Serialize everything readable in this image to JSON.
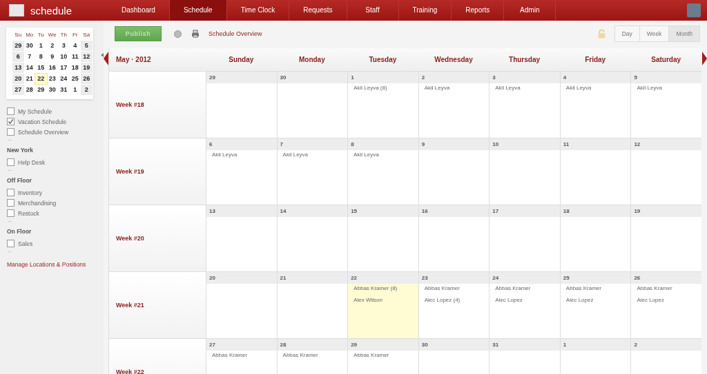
{
  "app": {
    "logo_text": "schedule"
  },
  "nav": [
    {
      "label": "Dashboard",
      "selected": false
    },
    {
      "label": "Schedule",
      "selected": true
    },
    {
      "label": "Time Clock",
      "selected": false
    },
    {
      "label": "Requests",
      "selected": false
    },
    {
      "label": "Staff",
      "selected": false
    },
    {
      "label": "Training",
      "selected": false
    },
    {
      "label": "Reports",
      "selected": false
    },
    {
      "label": "Admin",
      "selected": false
    }
  ],
  "sidebar": {
    "mini_calendar": {
      "weekdays": [
        "Su",
        "Mo",
        "Tu",
        "We",
        "Th",
        "Fr",
        "Sa"
      ],
      "weeks": [
        [
          {
            "day": "29",
            "today": false
          },
          {
            "day": "30",
            "today": false
          },
          {
            "day": "1",
            "today": false
          },
          {
            "day": "2",
            "today": false
          },
          {
            "day": "3",
            "today": false
          },
          {
            "day": "4",
            "today": false
          },
          {
            "day": "5",
            "today": false
          }
        ],
        [
          {
            "day": "6",
            "today": false
          },
          {
            "day": "7",
            "today": false
          },
          {
            "day": "8",
            "today": false
          },
          {
            "day": "9",
            "today": false
          },
          {
            "day": "10",
            "today": false
          },
          {
            "day": "11",
            "today": false
          },
          {
            "day": "12",
            "today": false
          }
        ],
        [
          {
            "day": "13",
            "today": false
          },
          {
            "day": "14",
            "today": false
          },
          {
            "day": "15",
            "today": false
          },
          {
            "day": "16",
            "today": false
          },
          {
            "day": "17",
            "today": false
          },
          {
            "day": "18",
            "today": false
          },
          {
            "day": "19",
            "today": false
          }
        ],
        [
          {
            "day": "20",
            "today": false
          },
          {
            "day": "21",
            "today": false
          },
          {
            "day": "22",
            "today": true
          },
          {
            "day": "23",
            "today": false
          },
          {
            "day": "24",
            "today": false
          },
          {
            "day": "25",
            "today": false
          },
          {
            "day": "26",
            "today": false
          }
        ],
        [
          {
            "day": "27",
            "today": false
          },
          {
            "day": "28",
            "today": false
          },
          {
            "day": "29",
            "today": false
          },
          {
            "day": "30",
            "today": false
          },
          {
            "day": "31",
            "today": false
          },
          {
            "day": "1",
            "today": false
          },
          {
            "day": "2",
            "today": false
          }
        ]
      ]
    },
    "groups": [
      {
        "items": [
          {
            "label": "My Schedule",
            "checked": false
          },
          {
            "label": "Vacation Schedule",
            "checked": true
          },
          {
            "label": "Schedule Overview",
            "checked": false
          }
        ],
        "more": "--"
      },
      {
        "heading": "New York",
        "items": [
          {
            "label": "Help Desk",
            "checked": false
          }
        ],
        "more": "--"
      },
      {
        "heading": "Off Floor",
        "items": [
          {
            "label": "Inventory",
            "checked": false
          },
          {
            "label": "Merchandising",
            "checked": false
          },
          {
            "label": "Restock",
            "checked": false
          }
        ],
        "more": "--"
      },
      {
        "heading": "On Floor",
        "items": [
          {
            "label": "Sales",
            "checked": false
          }
        ],
        "more": "--"
      }
    ],
    "manage_link": "Manage Locations & Positions"
  },
  "toolbar": {
    "publish": "Publish",
    "overview_link": "Schedule Overview",
    "views": [
      {
        "label": "Day",
        "selected": false
      },
      {
        "label": "Week",
        "selected": false
      },
      {
        "label": "Month",
        "selected": true
      }
    ]
  },
  "calendar": {
    "title": "May · 2012",
    "days": [
      "Sunday",
      "Monday",
      "Tuesday",
      "Wednesday",
      "Thursday",
      "Friday",
      "Saturday"
    ],
    "weeks": [
      {
        "label": "Week #18",
        "days": [
          {
            "date": "29",
            "today": false
          },
          {
            "date": "30",
            "today": false
          },
          {
            "date": "1",
            "today": false,
            "entries": [
              "Akil Leyva (8)"
            ]
          },
          {
            "date": "2",
            "today": false,
            "entries": [
              "Akil Leyva"
            ]
          },
          {
            "date": "3",
            "today": false,
            "entries": [
              "Akil Leyva"
            ]
          },
          {
            "date": "4",
            "today": false,
            "entries": [
              "Akil Leyva"
            ]
          },
          {
            "date": "5",
            "today": false,
            "entries": [
              "Akil Leyva"
            ]
          }
        ]
      },
      {
        "label": "Week #19",
        "days": [
          {
            "date": "6",
            "today": false,
            "entries": [
              "Akil Leyva"
            ]
          },
          {
            "date": "7",
            "today": false,
            "entries": [
              "Akil Leyva"
            ]
          },
          {
            "date": "8",
            "today": false,
            "entries": [
              "Akil Leyva"
            ]
          },
          {
            "date": "9",
            "today": false
          },
          {
            "date": "10",
            "today": false
          },
          {
            "date": "11",
            "today": false
          },
          {
            "date": "12",
            "today": false
          }
        ]
      },
      {
        "label": "Week #20",
        "days": [
          {
            "date": "13",
            "today": false
          },
          {
            "date": "14",
            "today": false
          },
          {
            "date": "15",
            "today": false
          },
          {
            "date": "16",
            "today": false
          },
          {
            "date": "17",
            "today": false
          },
          {
            "date": "18",
            "today": false
          },
          {
            "date": "19",
            "today": false
          }
        ]
      },
      {
        "label": "Week #21",
        "days": [
          {
            "date": "20",
            "today": false
          },
          {
            "date": "21",
            "today": false
          },
          {
            "date": "22",
            "today": true,
            "entries": [
              "Abbas Kramer (8)",
              "Alex Wilson"
            ]
          },
          {
            "date": "23",
            "today": false,
            "entries": [
              "Abbas Kramer",
              "Alec Lopez (4)"
            ]
          },
          {
            "date": "24",
            "today": false,
            "entries": [
              "Abbas Kramer",
              "Alec Lopez"
            ]
          },
          {
            "date": "25",
            "today": false,
            "entries": [
              "Abbas Kramer",
              "Alec Lopez"
            ]
          },
          {
            "date": "26",
            "today": false,
            "entries": [
              "Abbas Kramer",
              "Alec Lopez"
            ]
          }
        ]
      },
      {
        "label": "Week #22",
        "days": [
          {
            "date": "27",
            "today": false,
            "entries": [
              "Abbas Kramer"
            ]
          },
          {
            "date": "28",
            "today": false,
            "entries": [
              "Abbas Kramer"
            ]
          },
          {
            "date": "29",
            "today": false,
            "entries": [
              "Abbas Kramer"
            ]
          },
          {
            "date": "30",
            "today": false
          },
          {
            "date": "31",
            "today": false
          },
          {
            "date": "1",
            "today": false
          },
          {
            "date": "2",
            "today": false
          }
        ]
      }
    ]
  }
}
